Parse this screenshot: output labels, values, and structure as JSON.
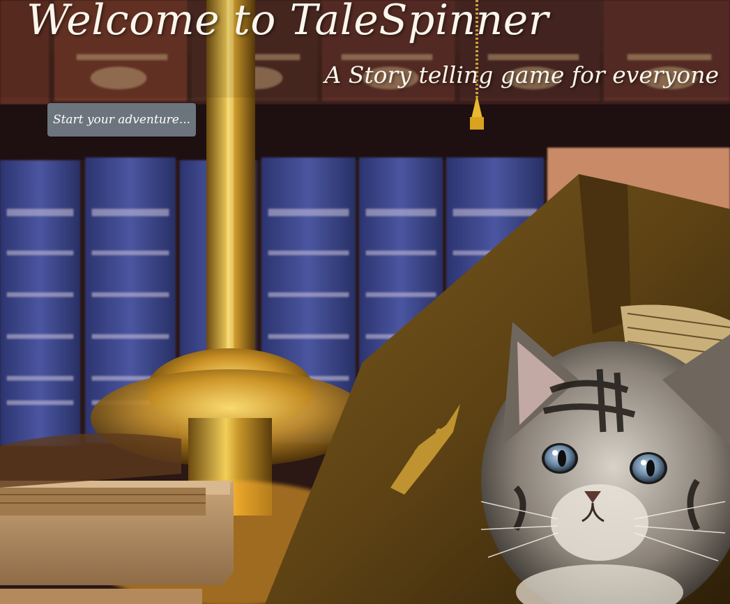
{
  "hero": {
    "title": "Welcome to TaleSpinner",
    "subtitle": "A Story telling game for everyone",
    "cta_label": "Start your adventure...",
    "background_image": "kitten-books-icon"
  },
  "colors": {
    "heading_text": "#fbf6ec",
    "button_bg": "#6c757d",
    "button_text": "#ffffff"
  }
}
